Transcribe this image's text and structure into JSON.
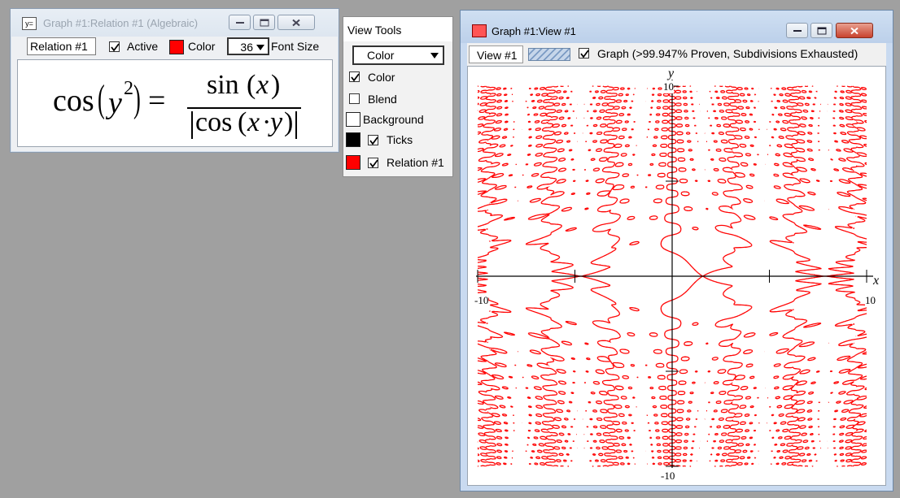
{
  "relation_window": {
    "title": "Graph #1:Relation #1 (Algebraic)",
    "name_value": "Relation #1",
    "active_label": "Active",
    "active_checked": true,
    "color_label": "Color",
    "color": "#ff0000",
    "font_size_value": "36",
    "font_size_label": "Font Size",
    "formula": {
      "lhs_func": "cos",
      "lhs_var": "y",
      "lhs_exp": "2",
      "eq": "=",
      "num_func": "sin",
      "num_var": "x",
      "den_func": "cos",
      "den_var1": "x",
      "den_dot": "·",
      "den_var2": "y"
    }
  },
  "view_tools": {
    "title": "View Tools",
    "mode_selected": "Color",
    "items": [
      {
        "label": "Color",
        "checked": true
      },
      {
        "label": "Blend",
        "checked": false
      },
      {
        "label": "Background",
        "color": "#ffffff"
      },
      {
        "label": "Ticks",
        "checked": true,
        "color": "#000000"
      },
      {
        "label": "Relation #1",
        "checked": true,
        "color": "#ff0000"
      }
    ]
  },
  "view_window": {
    "title": "Graph #1:View #1",
    "tab_label": "View #1",
    "graph_checked": true,
    "graph_status": "Graph (>99.947% Proven, Subdivisions Exhausted)"
  },
  "chart_data": {
    "type": "implicit",
    "relation": "cos(y^2) = sin(x)/|cos(x*y)|",
    "xlabel": "x",
    "ylabel": "y",
    "xlim": [
      -10,
      10
    ],
    "ylim": [
      -10,
      10
    ],
    "tick_labels": {
      "x_min": "-10",
      "x_max": "10",
      "y_min": "-10",
      "y_max": "10"
    },
    "curve_color": "#ff0000"
  }
}
